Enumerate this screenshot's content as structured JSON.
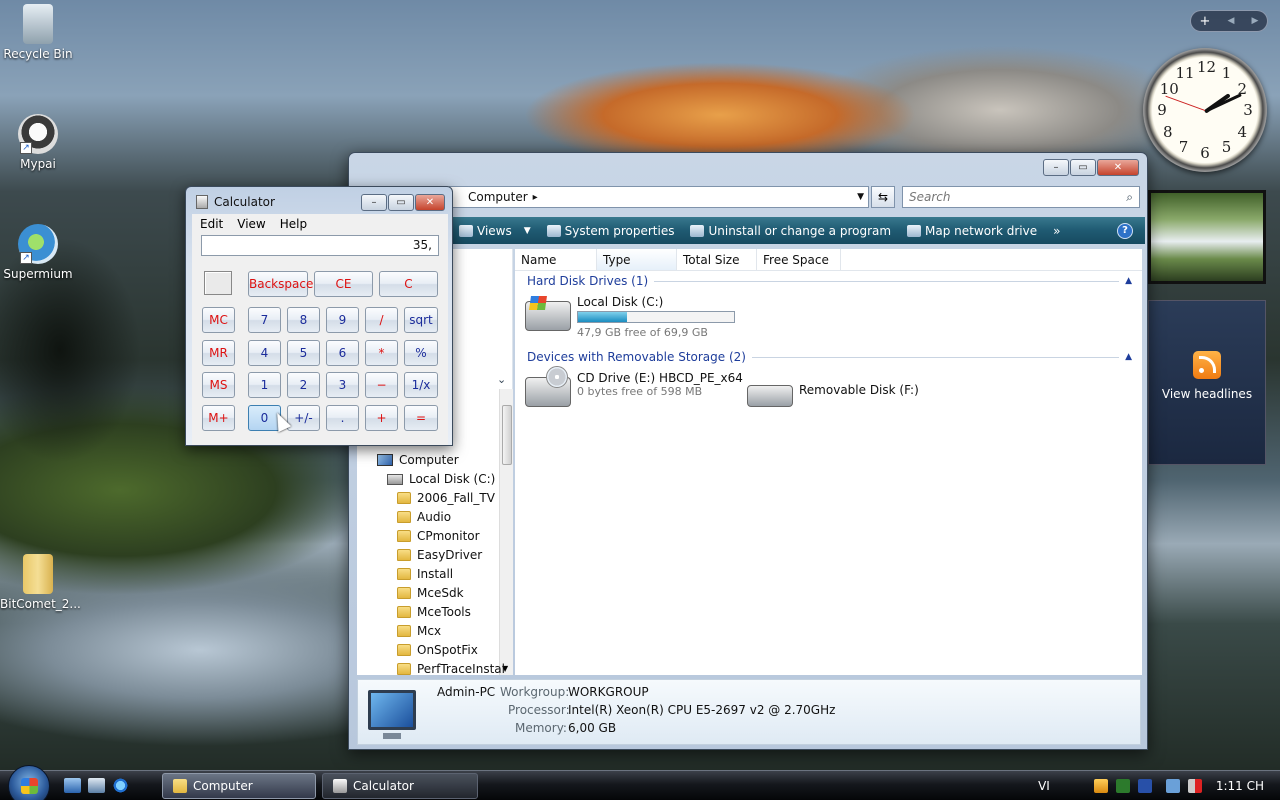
{
  "desktop": {
    "icons": [
      {
        "label": "Recycle Bin",
        "icon": "recycle-bin-icon"
      },
      {
        "label": "Mypai",
        "icon": "mypai-icon"
      },
      {
        "label": "Supermium",
        "icon": "supermium-browser-icon"
      },
      {
        "label": "BitComet_2...",
        "icon": "zip-archive-icon"
      }
    ]
  },
  "gadgets": {
    "control_plus": "+",
    "control_prev": "◀",
    "control_next": "▶",
    "clock_numbers": [
      "12",
      "1",
      "2",
      "3",
      "4",
      "5",
      "6",
      "7",
      "8",
      "9",
      "10",
      "11"
    ],
    "feed_label": "View headlines"
  },
  "explorer": {
    "address": "Computer",
    "address_arrow": "▸",
    "search_placeholder": "Search",
    "buttons": {
      "minimize": "–",
      "maximize": "▭",
      "close": "✕"
    },
    "toolbar": [
      {
        "label": "Views",
        "icon": "views-icon"
      },
      {
        "label": "System properties",
        "icon": "system-properties-icon"
      },
      {
        "label": "Uninstall or change a program",
        "icon": "uninstall-icon"
      },
      {
        "label": "Map network drive",
        "icon": "map-drive-icon"
      }
    ],
    "toolbar_more": "»",
    "help": "?",
    "columns": [
      "Name",
      "Type",
      "Total Size",
      "Free Space"
    ],
    "groups": [
      {
        "label": "Hard Disk Drives (1)"
      },
      {
        "label": "Devices with Removable Storage (2)"
      }
    ],
    "drives": {
      "c": {
        "name": "Local Disk (C:)",
        "free": "47,9 GB free of 69,9 GB",
        "used_fraction": 0.315
      },
      "e": {
        "name": "CD Drive (E:) HBCD_PE_x64",
        "free": "0 bytes free of 598 MB"
      },
      "f": {
        "name": "Removable Disk (F:)"
      }
    },
    "tree": [
      "Computer",
      "Local Disk (C:)",
      "2006_Fall_TV",
      "Audio",
      "CPmonitor",
      "EasyDriver",
      "Install",
      "MceSdk",
      "MceTools",
      "Mcx",
      "OnSpotFix",
      "PerfTraceInstal"
    ],
    "details": {
      "pc_name": "Admin-PC",
      "workgroup_label": "Workgroup:",
      "workgroup": "WORKGROUP",
      "processor_label": "Processor:",
      "processor": "Intel(R) Xeon(R) CPU E5-2697 v2 @ 2.70GHz",
      "memory_label": "Memory:",
      "memory": "6,00 GB"
    }
  },
  "calculator": {
    "title": "Calculator",
    "menu": [
      "Edit",
      "View",
      "Help"
    ],
    "display": "35,",
    "buttons": {
      "minimize": "–",
      "maximize": "▭",
      "close": "✕"
    },
    "top_row": [
      "Backspace",
      "CE",
      "C"
    ],
    "memory_col": [
      "MC",
      "MR",
      "MS",
      "M+"
    ],
    "rows": [
      [
        "7",
        "8",
        "9",
        "/",
        "sqrt"
      ],
      [
        "4",
        "5",
        "6",
        "*",
        "%"
      ],
      [
        "1",
        "2",
        "3",
        "−",
        "1/x"
      ],
      [
        "0",
        "+/-",
        ".",
        "+",
        "="
      ]
    ]
  },
  "taskbar": {
    "tasks": [
      {
        "label": "Computer"
      },
      {
        "label": "Calculator"
      }
    ],
    "language": "VI",
    "time": "1:11 CH"
  }
}
